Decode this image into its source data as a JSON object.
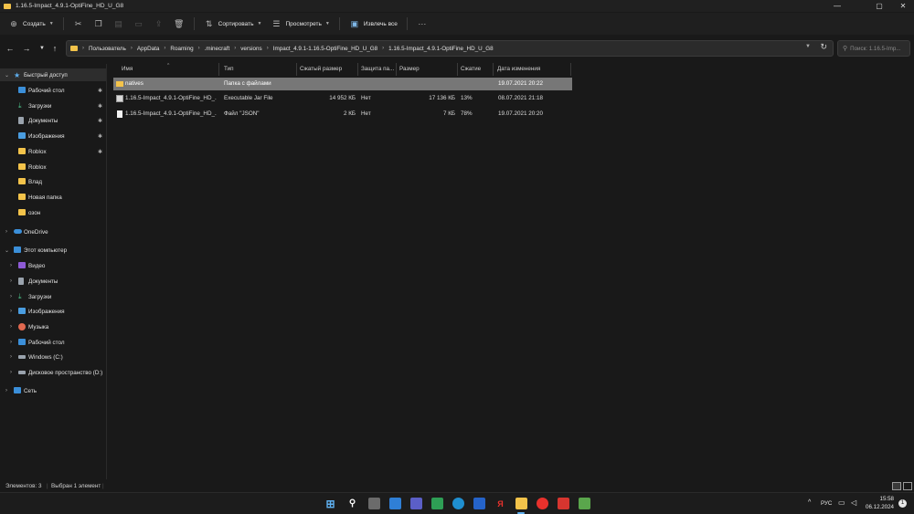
{
  "window": {
    "title": "1.16.5-Impact_4.9.1-OptiFine_HD_U_G8",
    "minimize_glyph": "—",
    "maximize_glyph": "▢",
    "close_glyph": "✕"
  },
  "toolbar": {
    "create_label": "Создать",
    "sort_label": "Сортировать",
    "view_label": "Просмотреть",
    "extract_label": "Извлечь все",
    "more_glyph": "···"
  },
  "breadcrumb": [
    "Пользователь",
    "AppData",
    "Roaming",
    ".minecraft",
    "versions",
    "Impact_4.9.1-1.16.5-OptiFine_HD_U_G8",
    "1.16.5-Impact_4.9.1-OptiFine_HD_U_G8"
  ],
  "search": {
    "placeholder": "Поиск: 1.16.5-Imp..."
  },
  "sidebar": {
    "quick_access": "Быстрый доступ",
    "quick_items": [
      {
        "label": "Рабочий стол",
        "icon": "desktop-icon",
        "pinned": true
      },
      {
        "label": "Загрузки",
        "icon": "downloads-icon",
        "pinned": true
      },
      {
        "label": "Документы",
        "icon": "documents-icon",
        "pinned": true
      },
      {
        "label": "Изображения",
        "icon": "pictures-icon",
        "pinned": true
      },
      {
        "label": "Roblox",
        "icon": "folder-icon",
        "pinned": true
      },
      {
        "label": "Roblox",
        "icon": "folder-icon",
        "pinned": false
      },
      {
        "label": "Влад",
        "icon": "folder-icon",
        "pinned": false
      },
      {
        "label": "Новая папка",
        "icon": "folder-icon",
        "pinned": false
      },
      {
        "label": "озон",
        "icon": "folder-icon",
        "pinned": false
      }
    ],
    "onedrive": "OneDrive",
    "this_pc": "Этот компьютер",
    "pc_items": [
      {
        "label": "Видео",
        "icon": "video-icon"
      },
      {
        "label": "Документы",
        "icon": "documents-icon"
      },
      {
        "label": "Загрузки",
        "icon": "downloads-icon"
      },
      {
        "label": "Изображения",
        "icon": "pictures-icon"
      },
      {
        "label": "Музыка",
        "icon": "music-icon"
      },
      {
        "label": "Рабочий стол",
        "icon": "desktop-icon"
      },
      {
        "label": "Windows (C:)",
        "icon": "drive-icon"
      },
      {
        "label": "Дисковое пространство (D:)",
        "icon": "drive-icon"
      }
    ],
    "network": "Сеть"
  },
  "columns": {
    "name": "Имя",
    "type": "Тип",
    "compressed": "Сжатый размер",
    "protected": "Защита па...",
    "size": "Размер",
    "ratio": "Сжатие",
    "date": "Дата изменения"
  },
  "files": [
    {
      "name": "natives",
      "type": "Папка с файлами",
      "compressed": "",
      "protected": "",
      "size": "",
      "ratio": "",
      "date": "19.07.2021 20:22",
      "kind": "folder"
    },
    {
      "name": "1.16.5-Impact_4.9.1-OptiFine_HD_...",
      "type": "Executable Jar File",
      "compressed": "14 952 КБ",
      "protected": "Нет",
      "size": "17 136 КБ",
      "ratio": "13%",
      "date": "08.07.2021 21:18",
      "kind": "jar"
    },
    {
      "name": "1.16.5-Impact_4.9.1-OptiFine_HD_...",
      "type": "Файл \"JSON\"",
      "compressed": "2 КБ",
      "protected": "Нет",
      "size": "7 КБ",
      "ratio": "78%",
      "date": "19.07.2021 20:20",
      "kind": "json"
    }
  ],
  "status": {
    "items_count": "Элементов: 3",
    "selected": "Выбран 1 элемент"
  },
  "tray": {
    "language": "РУС",
    "time": "15:58",
    "date": "06.12.2024",
    "notifications": "1"
  },
  "colors": {
    "accent": "#5fb0f0",
    "folder": "#f3c34a",
    "selected_row": "#777777"
  }
}
